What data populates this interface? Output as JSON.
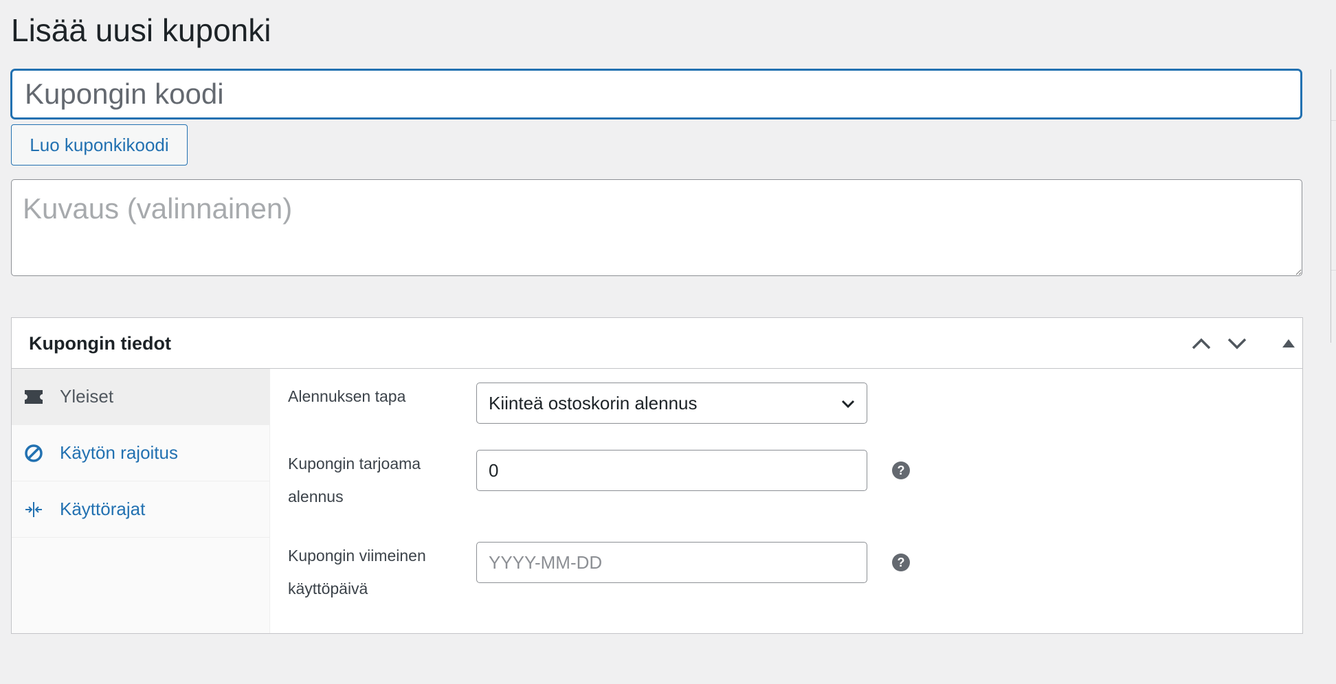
{
  "page": {
    "title": "Lisää uusi kuponki"
  },
  "coupon_code": {
    "value": "",
    "placeholder": "Kupongin koodi",
    "generate_label": "Luo kuponkikoodi"
  },
  "description": {
    "value": "",
    "placeholder": "Kuvaus (valinnainen)"
  },
  "metabox": {
    "title": "Kupongin tiedot",
    "tabs": [
      {
        "label": "Yleiset",
        "icon": "ticket-icon",
        "active": true
      },
      {
        "label": "Käytön rajoitus",
        "icon": "block-icon",
        "active": false
      },
      {
        "label": "Käyttörajat",
        "icon": "limit-icon",
        "active": false
      }
    ],
    "fields": {
      "discount_type": {
        "label": "Alennuksen tapa",
        "selected": "Kiinteä ostoskorin alennus"
      },
      "amount": {
        "label_line1": "Kupongin tarjoama",
        "label_line2": "alennus",
        "value": "0"
      },
      "expiry": {
        "label_line1": "Kupongin viimeinen",
        "label_line2": "käyttöpäivä",
        "value": "",
        "placeholder": "YYYY-MM-DD"
      }
    }
  },
  "colors": {
    "accent": "#2271b1",
    "background": "#f0f0f1",
    "text": "#1d2327",
    "help_icon": "#646970"
  }
}
